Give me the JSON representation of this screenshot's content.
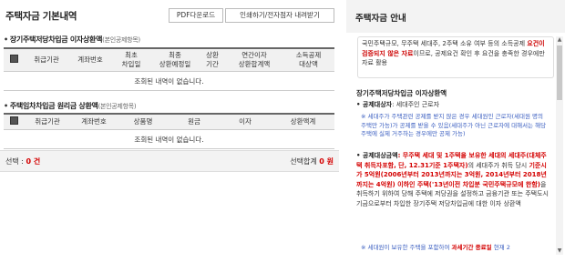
{
  "page": {
    "title": "주택자금 기본내역",
    "buttons": {
      "pdf": "PDF다운로드",
      "print": "인쇄하기/전자점자 내려받기"
    }
  },
  "section1": {
    "heading": "장기주택저당차입금 이자상환액",
    "heading_sub": "(본인공제항목)",
    "columns": [
      "",
      "취급기관",
      "계좌번호",
      "최초\n차입일",
      "최종\n상환예정일",
      "상환\n기간",
      "연간이자\n상환합계액",
      "소득공제\n대상액"
    ],
    "empty_message": "조회된 내역이 없습니다."
  },
  "section2": {
    "heading": "주택임차차입금 원리금 상환액",
    "heading_sub": "(본인공제항목)",
    "columns": [
      "",
      "취급기관",
      "계좌번호",
      "상품명",
      "원금",
      "이자",
      "상환액계"
    ],
    "empty_message": "조회된 내역이 없습니다."
  },
  "footer": {
    "selected_label": "선택 :",
    "selected_value": "0 건",
    "total_label": "선택합계",
    "total_value": "0 원"
  },
  "right_panel": {
    "title": "주택자금 안내",
    "notice_pre": "국민주택규모, 무주택 세대주, 2주택 소유 여부 등의 소득공제 ",
    "notice_bold": "요건이 검증되지 않은 자료",
    "notice_post": "이므로, 공제요건 확인 후 요건을 충족한 경우에만 자료 활용",
    "section_heading": "장기주택저당차입금 이자상환액",
    "target_label": "공제대상자",
    "target_value": ": 세대주인 근로자",
    "note1": "※ 세대주가 주택관련 공제를 받지 않은 경우 세대원인 근로자(세대원 명의 주택만 가능)가 공제를 받을 수 있음(세대주가 아닌 근로자에 대해서는 해당 주택에 실제 거주하는 경우에만 공제 가능)",
    "req_label": "공제대상금액",
    "req_red1": ": 무주택 세대 및 1주택을 보유한 세대의 세대주(대체주택 취득자포함, 단, 12.31기준 1주택자)",
    "req_mid": "의 세대주가 취득 당시 ",
    "req_red2": "기준시가 5억원(2006년부터 2013년까지는 3억원, 2014년부터 2018년까지는 4억원) 이하인 주택('13년이전 차입분 국민주택규모에 한함)",
    "req_tail": "을 취득하기 위하여 당해 주택에 저당권을 설정하고 금융기관 또는 주택도시기금으로부터 차입한 장기주택 저당차입금에 대한 이자 상환액",
    "note2_pre": "※ 세대원이 보유한 주택을 포함하여 ",
    "note2_red": "과세기간 종료일",
    "note2_post": " 현재 2"
  },
  "colors": {
    "accent_red": "#d40000",
    "note_blue": "#3a5ec0"
  }
}
